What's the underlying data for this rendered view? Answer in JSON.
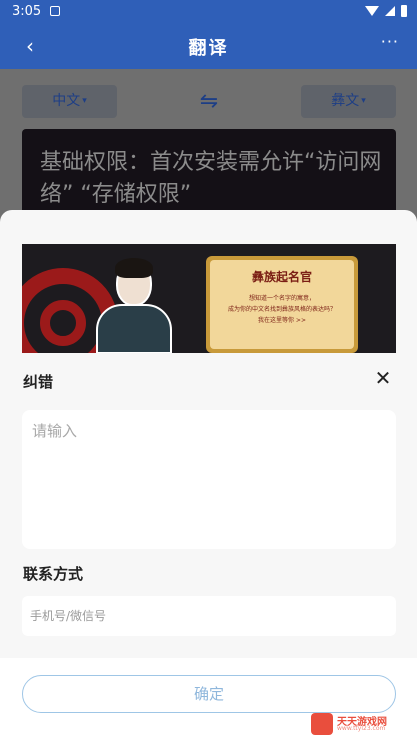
{
  "status_bar": {
    "time": "3:05"
  },
  "app_bar": {
    "back_glyph": "‹",
    "title": "翻译",
    "more_glyph": "···"
  },
  "language": {
    "source": "中文",
    "target": "彝文",
    "caret": "▾",
    "swap_glyph": "⇋"
  },
  "text_card": {
    "text": "基础权限：首次安装需允许“访问网络” “存储权限”"
  },
  "banner": {
    "sign_title": "彝族起名官",
    "sign_lines": [
      "想知道一个名字的寓意，",
      "成为你的中文名找到彝族风格的表达吗？",
      "我在这里等你 >>"
    ]
  },
  "correction": {
    "title": "纠错",
    "close_glyph": "✕",
    "placeholder": "请输入",
    "value": ""
  },
  "contact": {
    "title": "联系方式",
    "placeholder": "手机号/微信号",
    "value": ""
  },
  "confirm_button": {
    "label": "确定"
  },
  "watermark": {
    "name": "天天游戏网",
    "url": "www.ttyl23.com"
  },
  "colors": {
    "primary": "#2f5fb8",
    "confirm_border": "#9fc6e6",
    "confirm_text": "#8fb7dc",
    "watermark": "#e94e3d"
  },
  "icons": [
    "back-icon",
    "more-icon",
    "swap-icon",
    "caret-down-icon",
    "close-icon",
    "wifi-icon",
    "signal-icon",
    "battery-icon"
  ]
}
